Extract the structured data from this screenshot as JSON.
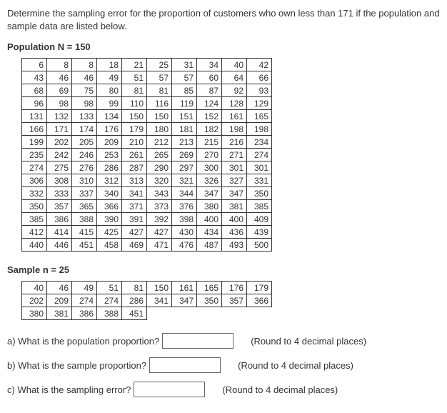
{
  "problem_text": "Determine the sampling error for the proportion of customers who own less than 171 if the population and sample data are listed below.",
  "population_label": "Population N = 150",
  "sample_label": "Sample n = 25",
  "population_data": [
    [
      6,
      8,
      8,
      18,
      21,
      25,
      31,
      34,
      40,
      42
    ],
    [
      43,
      46,
      46,
      49,
      51,
      57,
      57,
      60,
      64,
      66
    ],
    [
      68,
      69,
      75,
      80,
      81,
      81,
      85,
      87,
      92,
      93
    ],
    [
      96,
      98,
      98,
      99,
      110,
      116,
      119,
      124,
      128,
      129
    ],
    [
      131,
      132,
      133,
      134,
      150,
      150,
      151,
      152,
      161,
      165
    ],
    [
      166,
      171,
      174,
      176,
      179,
      180,
      181,
      182,
      198,
      198
    ],
    [
      199,
      202,
      205,
      209,
      210,
      212,
      213,
      215,
      216,
      234
    ],
    [
      235,
      242,
      246,
      253,
      261,
      265,
      269,
      270,
      271,
      274
    ],
    [
      274,
      275,
      276,
      286,
      287,
      290,
      297,
      300,
      301,
      301
    ],
    [
      306,
      308,
      310,
      312,
      313,
      320,
      321,
      326,
      327,
      331
    ],
    [
      332,
      333,
      337,
      340,
      341,
      343,
      344,
      347,
      347,
      350
    ],
    [
      350,
      357,
      365,
      366,
      371,
      373,
      376,
      380,
      381,
      385
    ],
    [
      385,
      386,
      388,
      390,
      391,
      392,
      398,
      400,
      400,
      409
    ],
    [
      412,
      414,
      415,
      425,
      427,
      427,
      430,
      434,
      436,
      439
    ],
    [
      440,
      446,
      451,
      458,
      469,
      471,
      476,
      487,
      493,
      500
    ]
  ],
  "sample_data": [
    [
      40,
      46,
      49,
      51,
      81,
      150,
      161,
      165,
      176,
      179
    ],
    [
      202,
      209,
      274,
      274,
      286,
      341,
      347,
      350,
      357,
      366
    ],
    [
      380,
      381,
      386,
      388,
      451,
      null,
      null,
      null,
      null,
      null
    ]
  ],
  "questions": {
    "a": {
      "text": "a) What is the population proportion?",
      "hint": "(Round to 4 decimal places)"
    },
    "b": {
      "text": "b) What is the sample proportion?",
      "hint": "(Round to 4 decimal places)"
    },
    "c": {
      "text": "c) What is the sampling error?",
      "hint": "(Round to 4 decimal places)"
    }
  }
}
